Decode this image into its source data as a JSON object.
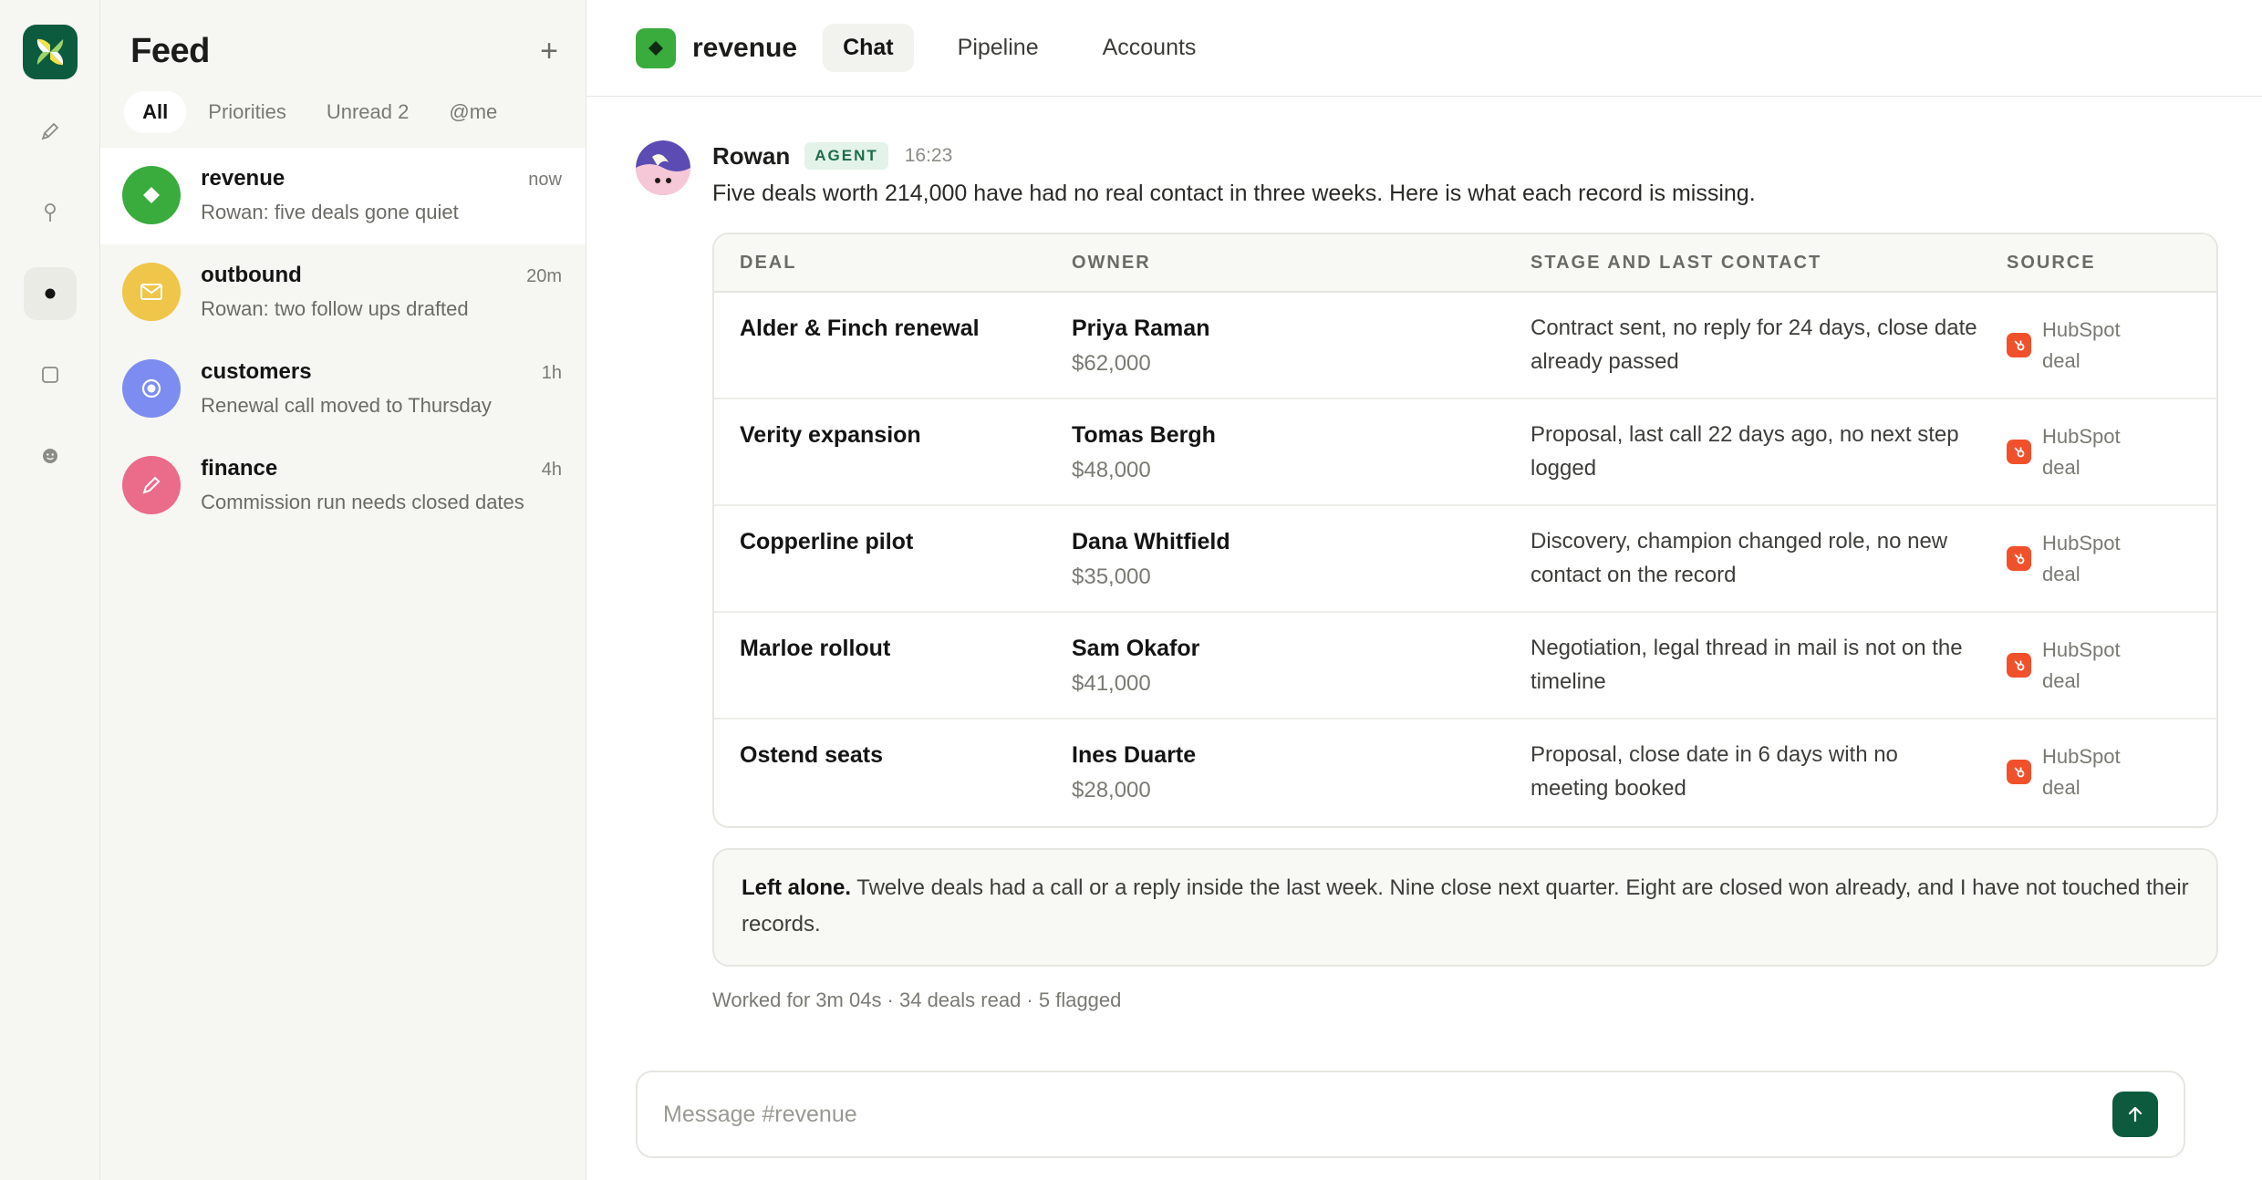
{
  "feed": {
    "title": "Feed",
    "new_icon": "plus-icon",
    "filters": [
      {
        "label": "All"
      },
      {
        "label": "Priorities"
      },
      {
        "label": "Unread 2"
      },
      {
        "label": "@me"
      }
    ],
    "items": [
      {
        "name": "revenue",
        "time": "now",
        "preview": "Rowan: five deals gone quiet",
        "color": "#3aab3d",
        "icon": "diamond-icon"
      },
      {
        "name": "outbound",
        "time": "20m",
        "preview": "Rowan: two follow ups drafted",
        "color": "#efc54a",
        "icon": "mail-icon"
      },
      {
        "name": "customers",
        "time": "1h",
        "preview": "Renewal call moved to Thursday",
        "color": "#7c8cf0",
        "icon": "target-icon"
      },
      {
        "name": "finance",
        "time": "4h",
        "preview": "Commission run needs closed dates",
        "color": "#ea6b8a",
        "icon": "pencil-icon"
      }
    ]
  },
  "rail": {
    "items": [
      {
        "icon": "pencil-icon"
      },
      {
        "icon": "pin-icon"
      },
      {
        "icon": "dot-icon"
      },
      {
        "icon": "square-icon"
      },
      {
        "icon": "smiley-icon"
      }
    ]
  },
  "header": {
    "channel": "revenue",
    "tabs": [
      {
        "label": "Chat"
      },
      {
        "label": "Pipeline"
      },
      {
        "label": "Accounts"
      }
    ]
  },
  "message": {
    "author": "Rowan",
    "badge": "AGENT",
    "time": "16:23",
    "text": "Five deals worth 214,000 have had no real contact in three weeks. Here is what each record is missing."
  },
  "table": {
    "headers": [
      "DEAL",
      "OWNER",
      "STAGE AND LAST CONTACT",
      "SOURCE"
    ],
    "rows": [
      {
        "deal": "Alder & Finch renewal",
        "owner": "Priya Raman",
        "amount": "$62,000",
        "stage": "Contract sent, no reply for 24 days, close date already passed",
        "source": "HubSpot deal"
      },
      {
        "deal": "Verity expansion",
        "owner": "Tomas Bergh",
        "amount": "$48,000",
        "stage": "Proposal, last call 22 days ago, no next step logged",
        "source": "HubSpot deal"
      },
      {
        "deal": "Copperline pilot",
        "owner": "Dana Whitfield",
        "amount": "$35,000",
        "stage": "Discovery, champion changed role, no new contact on the record",
        "source": "HubSpot deal"
      },
      {
        "deal": "Marloe rollout",
        "owner": "Sam Okafor",
        "amount": "$41,000",
        "stage": "Negotiation, legal thread in mail is not on the timeline",
        "source": "HubSpot deal"
      },
      {
        "deal": "Ostend seats",
        "owner": "Ines Duarte",
        "amount": "$28,000",
        "stage": "Proposal, close date in 6 days with no meeting booked",
        "source": "HubSpot deal"
      }
    ]
  },
  "note": {
    "lead": "Left alone.",
    "text": "Twelve deals had a call or a reply inside the last week. Nine close next quarter. Eight are closed won already, and I have not touched their records."
  },
  "worked": "Worked for 3m 04s · 34 deals read · 5 flagged",
  "composer": {
    "placeholder": "Message #revenue"
  }
}
